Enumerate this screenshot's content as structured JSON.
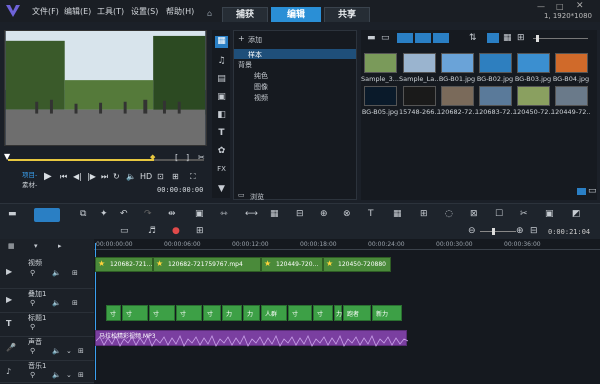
{
  "menu": {
    "file": "文件(F)",
    "edit": "编辑(E)",
    "tools": "工具(T)",
    "settings": "设置(S)",
    "help": "帮助(H)"
  },
  "tabs": {
    "capture": "捕获",
    "edit": "编辑",
    "share": "共享"
  },
  "resolution": "1, 1920*1080",
  "player": {
    "project_label": "项目-",
    "clip_label": "素材-",
    "timecode": "00:00:00:00"
  },
  "library": {
    "add_label": "添加",
    "browse_label": "浏览",
    "tree": [
      "样本",
      "背景",
      "纯色",
      "图像",
      "视频"
    ],
    "thumbs": [
      {
        "label": "Sample_3...",
        "color": "#7a9a5a"
      },
      {
        "label": "Sample_La...",
        "color": "#9ab4cf"
      },
      {
        "label": "BG-B01.jpg",
        "color": "#6aa3d8"
      },
      {
        "label": "BG-B02.jpg",
        "color": "#2e7fbf"
      },
      {
        "label": "BG-B03.jpg",
        "color": "#3b8fd0"
      },
      {
        "label": "BG-B04.jpg",
        "color": "#d06a2a"
      },
      {
        "label": "BG-B05.jpg",
        "color": "#0a1a2a"
      },
      {
        "label": "15748-266...",
        "color": "#1a1a1a"
      },
      {
        "label": "120682-72...",
        "color": "#7a6a5a"
      },
      {
        "label": "120683-72...",
        "color": "#5a7a9a"
      },
      {
        "label": "120450-72...",
        "color": "#8aa060"
      },
      {
        "label": "120449-72...",
        "color": "#6a7a8a"
      }
    ]
  },
  "timeline": {
    "ruler": [
      "00:00:00:00",
      "00:00:06:00",
      "00:00:12:00",
      "00:00:18:00",
      "00:00:24:00",
      "00:00:30:00",
      "00:00:36:00"
    ],
    "end_timecode": "0:00:21:04",
    "tracks": [
      {
        "name": "视频",
        "type": "video"
      },
      {
        "name": "叠加1",
        "type": "overlay"
      },
      {
        "name": "标题1",
        "type": "title"
      },
      {
        "name": "声音",
        "type": "voice"
      },
      {
        "name": "音乐1",
        "type": "music"
      }
    ],
    "video_clips": [
      "120682-721...",
      "120682-721759767.mp4",
      "120449-720...",
      "120450-720880"
    ],
    "title_clips": [
      "寸",
      "寸",
      "寸",
      "寸",
      "寸",
      "力",
      "力",
      "人群",
      "寸",
      "寸",
      "力",
      "跑者",
      "新力"
    ],
    "audio_label": "马拉松精彩视频.MP3"
  }
}
